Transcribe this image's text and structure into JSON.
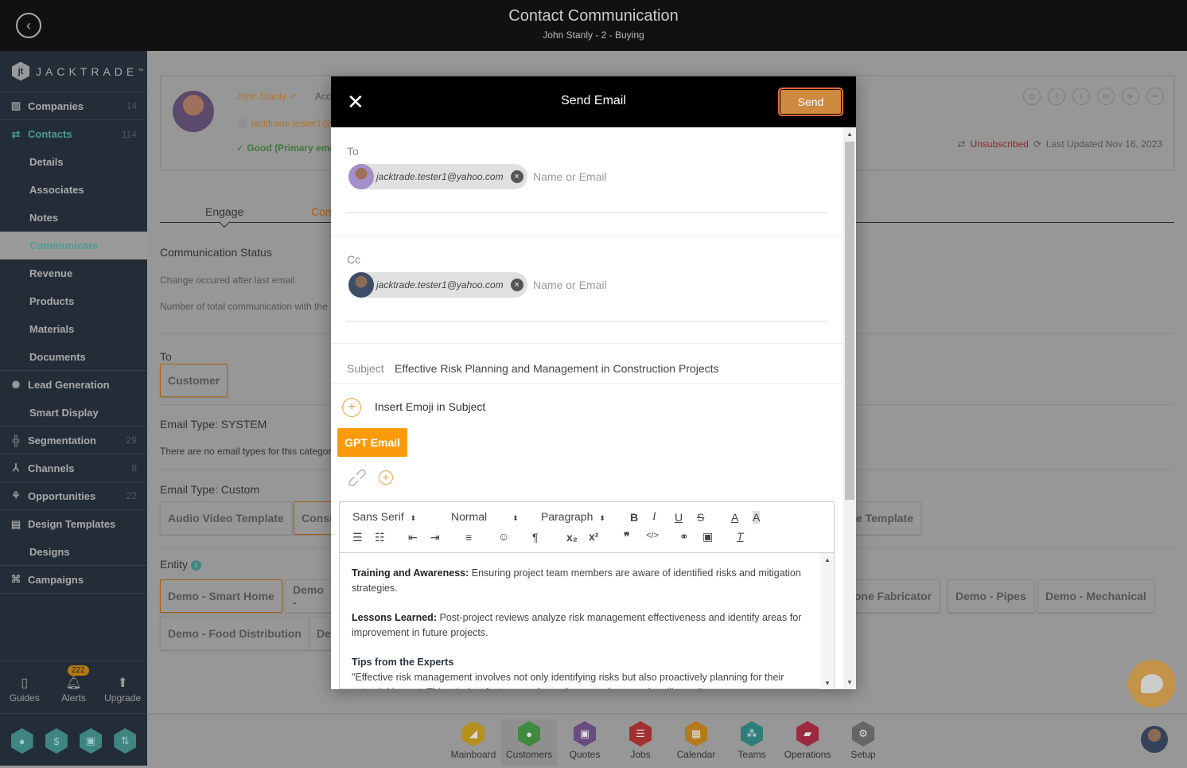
{
  "header": {
    "title": "Contact Communication",
    "subtitle": "John Stanly - 2 - Buying",
    "back_icon": "chevron-left-circle"
  },
  "sidebar": {
    "logo_text": "JACKTRADE",
    "logo_tm": "™",
    "items": [
      {
        "label": "Companies",
        "count": "14",
        "icon": "building-icon"
      },
      {
        "label": "Contacts",
        "count": "114",
        "icon": "contacts-icon"
      },
      {
        "label": "Details"
      },
      {
        "label": "Associates"
      },
      {
        "label": "Notes"
      },
      {
        "label": "Communicate"
      },
      {
        "label": "Revenue"
      },
      {
        "label": "Products"
      },
      {
        "label": "Materials"
      },
      {
        "label": "Documents"
      },
      {
        "label": "Lead Generation",
        "icon": "network-icon"
      },
      {
        "label": "Smart Display"
      },
      {
        "label": "Segmentation",
        "count": "29",
        "icon": "segment-icon"
      },
      {
        "label": "Channels",
        "count": "8",
        "icon": "channels-icon"
      },
      {
        "label": "Opportunities",
        "count": "22",
        "icon": "opportunity-icon"
      },
      {
        "label": "Design Templates",
        "icon": "template-icon"
      },
      {
        "label": "Designs"
      },
      {
        "label": "Campaigns",
        "icon": "campaign-icon"
      }
    ],
    "bottom": {
      "guides": "Guides",
      "alerts": "Alerts",
      "alerts_badge": "222",
      "upgrade": "Upgrade"
    }
  },
  "contact": {
    "name": "John Stanly",
    "account_prefix": "Acc",
    "email_partial": "jacktrade.tester1@",
    "email_status": "Good (Primary ema",
    "unsubscribed": "Unsubscribed",
    "last_updated": "Last Updated Nov 16, 2023"
  },
  "tabs": [
    {
      "label": "Engage"
    },
    {
      "label": "Com"
    }
  ],
  "communication": {
    "status_title": "Communication Status",
    "change_text": "Change occured after last email",
    "total_text": "Number of total communication with the",
    "to_label": "To",
    "to_chip": "Customer",
    "system_title": "Email Type: SYSTEM",
    "system_empty": "There are no email types for this categor",
    "custom_title": "Email Type: Custom",
    "custom_chips": [
      "Audio Video Template",
      "Const",
      "e Template"
    ],
    "entity_title": "Entity",
    "entity_chips_row1": [
      "Demo - Smart Home",
      "Demo -",
      "tone Fabricator",
      "Demo - Pipes",
      "Demo - Mechanical"
    ],
    "entity_chips_row2": [
      "Demo - Food Distribution",
      "De"
    ]
  },
  "dock": {
    "items": [
      {
        "label": "Mainboard",
        "color": "#b6901f"
      },
      {
        "label": "Customers",
        "color": "#3f8a3e"
      },
      {
        "label": "Quotes",
        "color": "#6a4b82"
      },
      {
        "label": "Jobs",
        "color": "#a33030"
      },
      {
        "label": "Calendar",
        "color": "#b57a1c"
      },
      {
        "label": "Teams",
        "color": "#2f7d7a"
      },
      {
        "label": "Operations",
        "color": "#9b2a40"
      },
      {
        "label": "Setup",
        "color": "#666666"
      }
    ]
  },
  "modal": {
    "title": "Send Email",
    "send_label": "Send",
    "to_label": "To",
    "to_recipient": "jacktrade.tester1@yahoo.com",
    "to_placeholder": "Name or Email",
    "cc_label": "Cc",
    "cc_recipient": "jacktrade.tester1@yahoo.com",
    "cc_placeholder": "Name or Email",
    "subject_label": "Subject",
    "subject_value": "Effective Risk Planning and Management in Construction Projects",
    "insert_emoji": "Insert Emoji in Subject",
    "gpt_label": "GPT Email",
    "editor": {
      "font": "Sans Serif",
      "size": "Normal",
      "format": "Paragraph",
      "content": [
        {
          "bold": "Training and Awareness:",
          "text": " Ensuring project team members are aware of identified risks and mitigation strategies."
        },
        {
          "bold": "Lessons Learned:",
          "text": " Post-project reviews analyze risk management effectiveness and identify areas for improvement in future projects."
        }
      ],
      "heading": "Tips from the Experts",
      "quote": "\"Effective risk management involves not only identifying risks but also proactively planning for their potential impact. This mindset fosters a culture of preparedness and resilience.\""
    }
  },
  "colors": {
    "accent": "#f5a13c",
    "gpt": "#fb9b0b",
    "send": "#d08a40",
    "teal": "#4a9a96",
    "unsubscribed": "#8c2a2a"
  }
}
